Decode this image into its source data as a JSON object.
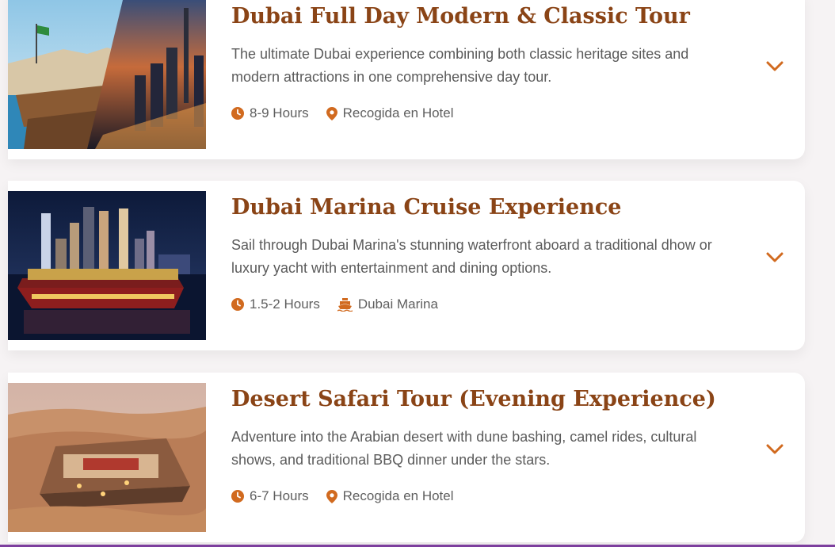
{
  "accent_color": "#d16a1f",
  "title_color": "#8a4416",
  "tours": [
    {
      "title": "Dubai Full Day Modern & Classic Tour",
      "description": "The ultimate Dubai experience combining both classic heritage sites and modern attractions in one comprehensive day tour.",
      "duration": "8-9 Hours",
      "location": "Recogida en Hotel",
      "location_icon": "map-pin-icon",
      "image": "dubai-classic-modern-photo"
    },
    {
      "title": "Dubai Marina Cruise Experience",
      "description": "Sail through Dubai Marina's stunning waterfront aboard a traditional dhow or luxury yacht with entertainment and dining options.",
      "duration": "1.5-2 Hours",
      "location": "Dubai Marina",
      "location_icon": "ship-icon",
      "image": "dubai-marina-dhow-photo"
    },
    {
      "title": "Desert Safari Tour (Evening Experience)",
      "description": "Adventure into the Arabian desert with dune bashing, camel rides, cultural shows, and traditional BBQ dinner under the stars.",
      "duration": "6-7 Hours",
      "location": "Recogida en Hotel",
      "location_icon": "map-pin-icon",
      "image": "desert-camp-photo"
    }
  ]
}
